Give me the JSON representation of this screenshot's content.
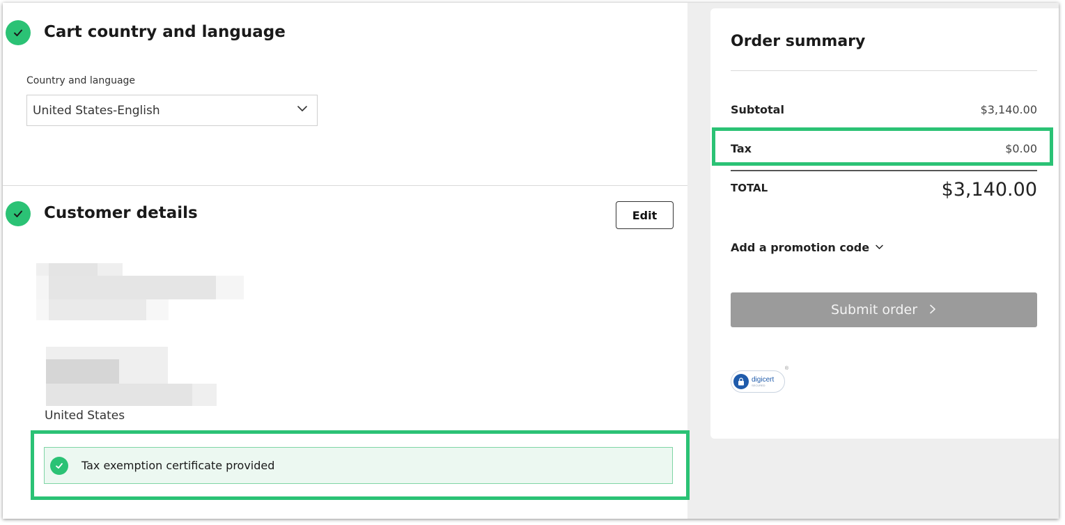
{
  "cart_section": {
    "title": "Cart country and language",
    "field_label": "Country and language",
    "selected_value": "United States-English"
  },
  "customer_section": {
    "title": "Customer details",
    "edit_label": "Edit",
    "country": "United States",
    "tax_exemption_text": "Tax exemption certificate provided"
  },
  "summary": {
    "title": "Order summary",
    "subtotal_label": "Subtotal",
    "subtotal_value": "$3,140.00",
    "tax_label": "Tax",
    "tax_value": "$0.00",
    "total_label": "TOTAL",
    "total_value": "$3,140.00",
    "promo_label": "Add a promotion code",
    "submit_label": "Submit order"
  },
  "badge": {
    "brand": "digicert",
    "sub": "SECURED",
    "mark": "®"
  },
  "colors": {
    "accent_green": "#2bc275",
    "submit_disabled": "#9b9b9b",
    "digicert_blue": "#1f5bab"
  }
}
